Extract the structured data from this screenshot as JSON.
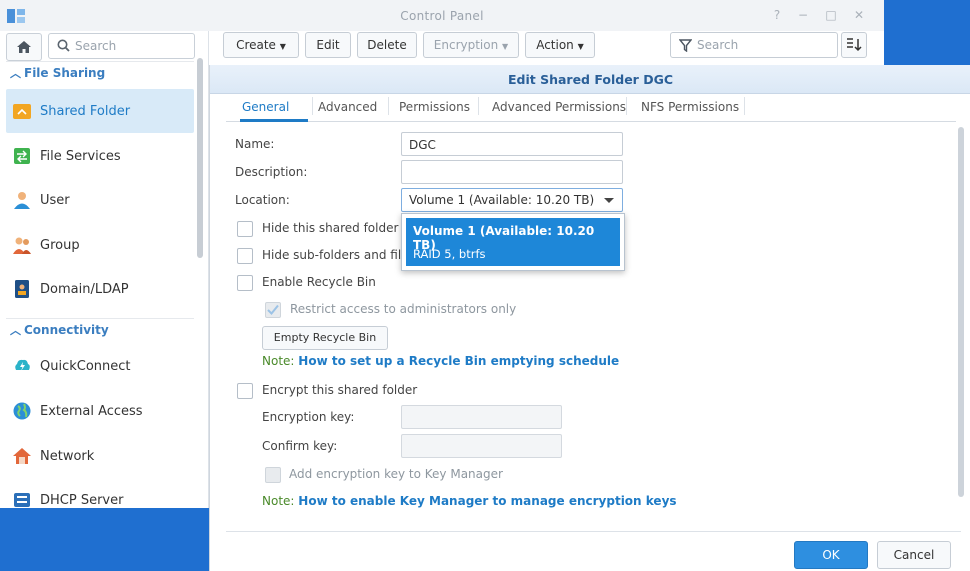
{
  "window": {
    "title": "Control Panel",
    "controls": {
      "help": "?",
      "minimize": "−",
      "maximize": "□",
      "close": "✕"
    }
  },
  "sidebar": {
    "search_placeholder": "Search",
    "groups": [
      {
        "label": "File Sharing"
      },
      {
        "label": "Connectivity"
      }
    ],
    "items": [
      {
        "label": "Shared Folder",
        "icon": "folder-share-icon",
        "selected": true
      },
      {
        "label": "File Services",
        "icon": "file-services-icon"
      },
      {
        "label": "User",
        "icon": "user-icon"
      },
      {
        "label": "Group",
        "icon": "group-icon"
      },
      {
        "label": "Domain/LDAP",
        "icon": "domain-ldap-icon"
      },
      {
        "label": "QuickConnect",
        "icon": "quickconnect-icon"
      },
      {
        "label": "External Access",
        "icon": "globe-icon"
      },
      {
        "label": "Network",
        "icon": "network-house-icon"
      },
      {
        "label": "DHCP Server",
        "icon": "dhcp-server-icon"
      }
    ]
  },
  "toolbar": {
    "create": "Create",
    "edit": "Edit",
    "delete": "Delete",
    "encryption": "Encryption",
    "action": "Action",
    "search_placeholder": "Search"
  },
  "dialog": {
    "title": "Edit Shared Folder DGC",
    "tabs": [
      "General",
      "Advanced",
      "Permissions",
      "Advanced Permissions",
      "NFS Permissions"
    ],
    "active_tab": "General",
    "fields": {
      "name_label": "Name:",
      "name_value": "DGC",
      "description_label": "Description:",
      "description_value": "",
      "location_label": "Location:",
      "location_value": "Volume 1 (Available: 10.20 TB)"
    },
    "location_dropdown": {
      "line1": "Volume 1 (Available: 10.20 TB)",
      "line2": "RAID 5, btrfs"
    },
    "options": {
      "hide_folder": "Hide this shared folder in",
      "hide_subfolders": "Hide sub-folders and files",
      "recycle_bin": "Enable Recycle Bin",
      "restrict_admin": "Restrict access to administrators only",
      "empty_recycle_bin": "Empty Recycle Bin",
      "note_recycle_prefix": "Note:",
      "note_recycle_link": "How to set up a Recycle Bin emptying schedule",
      "encrypt": "Encrypt this shared folder",
      "encryption_key_label": "Encryption key:",
      "confirm_key_label": "Confirm key:",
      "add_key_manager": "Add encryption key to Key Manager",
      "note_key_prefix": "Note:",
      "note_key_link": "How to enable Key Manager to manage encryption keys"
    },
    "buttons": {
      "ok": "OK",
      "cancel": "Cancel"
    }
  },
  "colors": {
    "accent": "#1e7bc6",
    "selected_bg": "#d8eaf8",
    "desktop": "#1f6fd0",
    "primary_button": "#2e8fe0"
  }
}
